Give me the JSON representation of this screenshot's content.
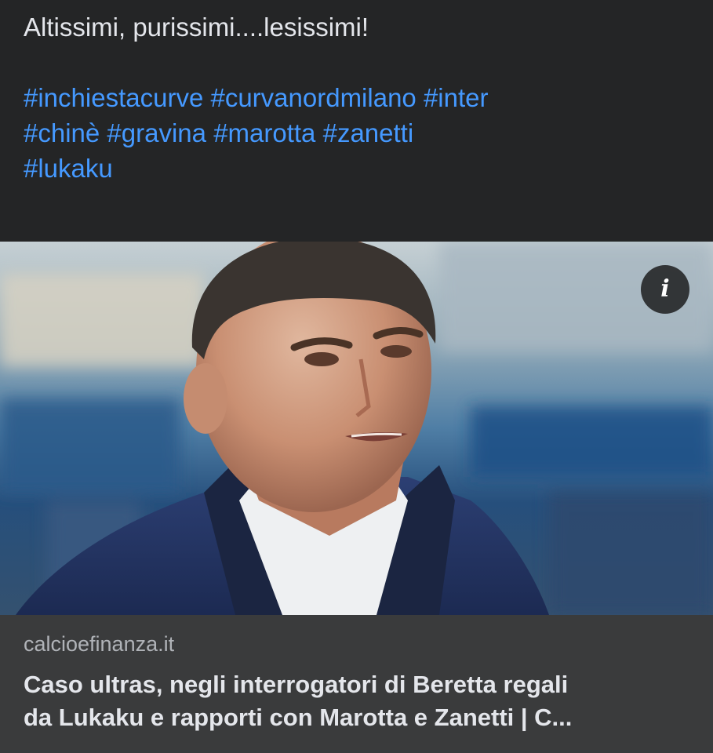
{
  "post": {
    "caption": "Altissimi, purissimi....lesissimi!",
    "hashtag_lines": [
      [
        "#inchiestacurve",
        "#curvanordmilano",
        "#inter"
      ],
      [
        "#chinè",
        "#gravina",
        "#marotta",
        "#zanetti"
      ],
      [
        "#lukaku"
      ]
    ]
  },
  "link_preview": {
    "image_icon": "info-icon",
    "info_glyph": "i",
    "domain": "calcioefinanza.it",
    "title_line_1": "Caso ultras, negli interrogatori di Beretta regali",
    "title_line_2": "da Lukaku e rapporti con Marotta e Zanetti | C..."
  },
  "colors": {
    "background": "#242526",
    "card_meta_background": "#3a3b3c",
    "hashtag": "#4599ff",
    "text_primary": "#e4e6eb",
    "text_secondary": "#b0b3b8"
  }
}
